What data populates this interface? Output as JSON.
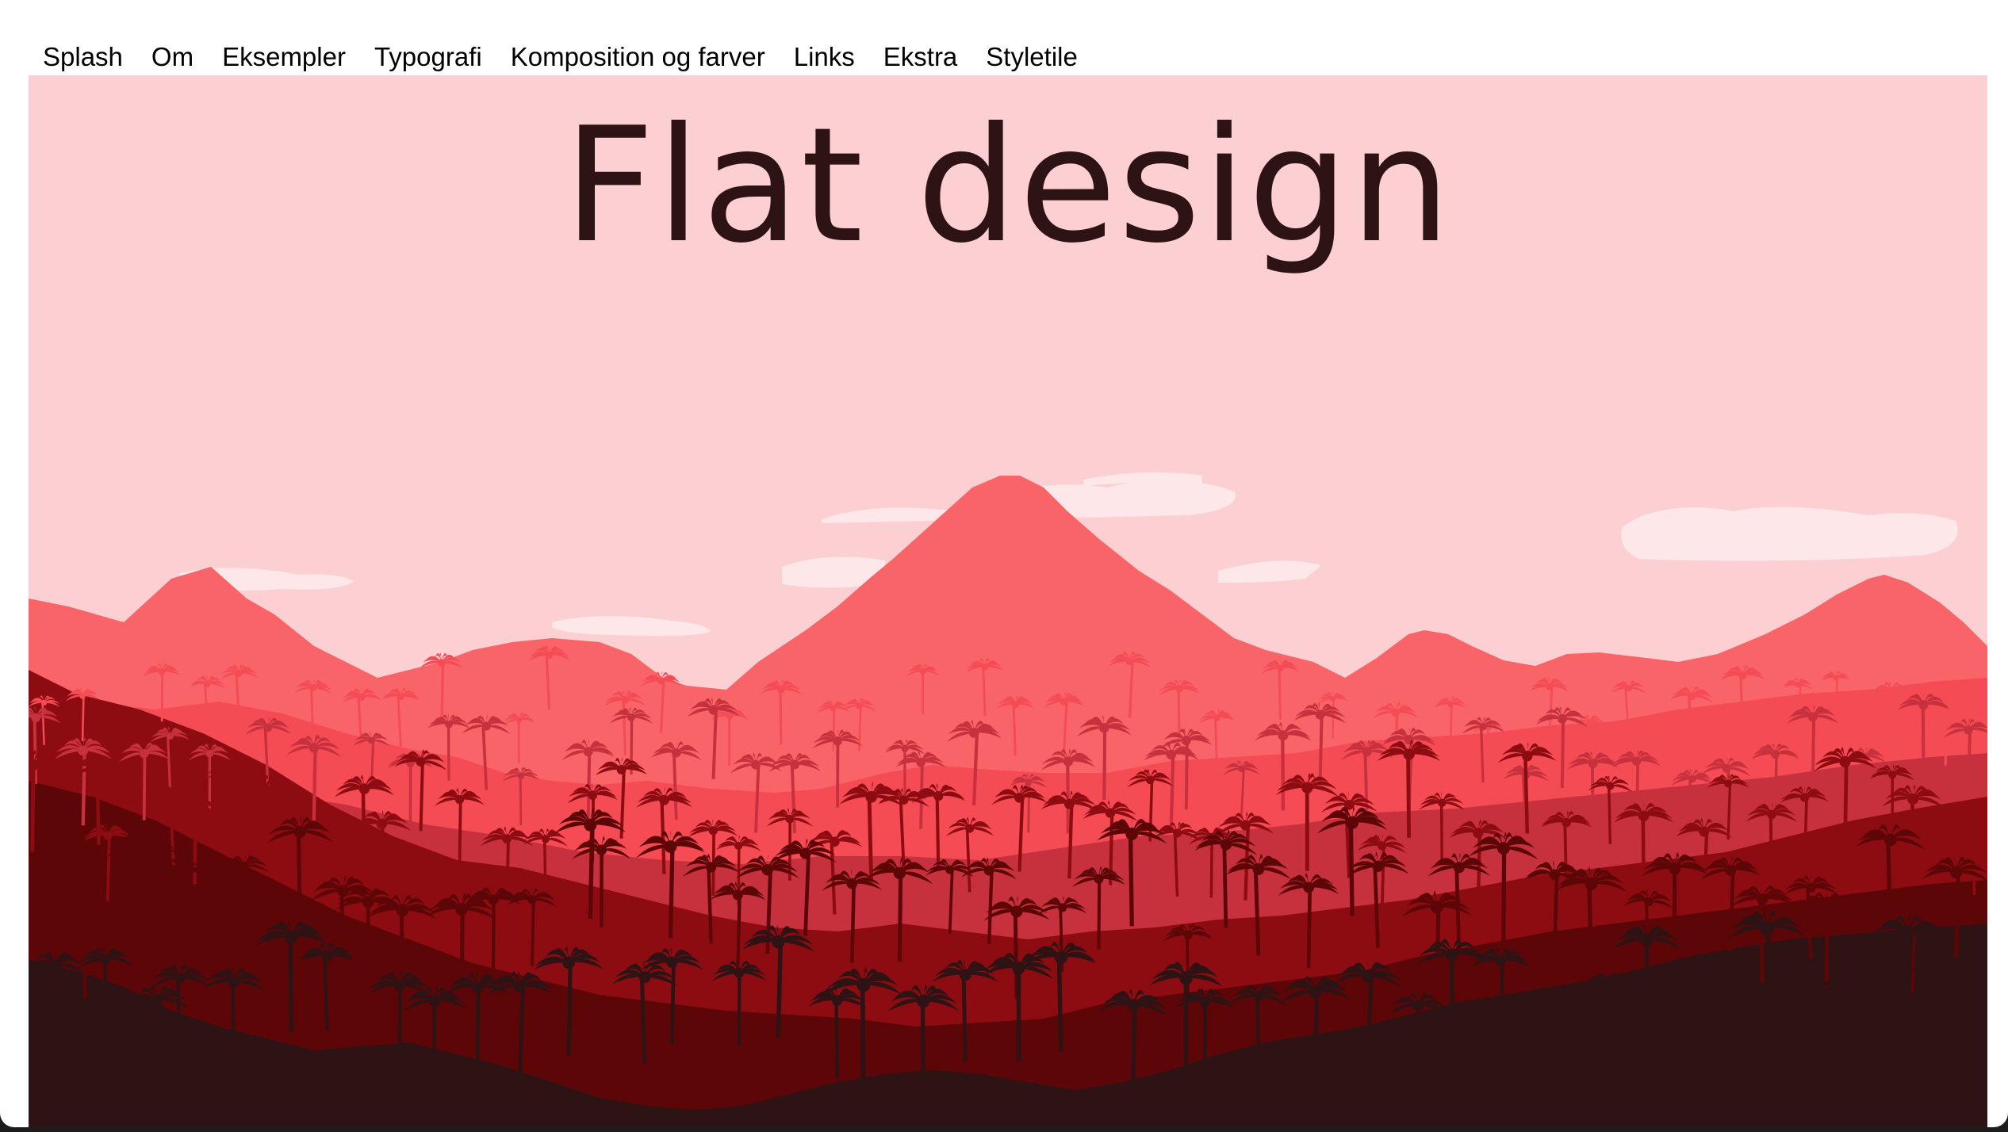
{
  "nav": {
    "items": [
      {
        "label": "Splash"
      },
      {
        "label": "Om"
      },
      {
        "label": "Eksempler"
      },
      {
        "label": "Typografi"
      },
      {
        "label": "Komposition og farver"
      },
      {
        "label": "Links"
      },
      {
        "label": "Ekstra"
      },
      {
        "label": "Styletile"
      }
    ]
  },
  "hero": {
    "title": "Flat design"
  },
  "colors": {
    "sky": "#fcd0d2",
    "cloud": "#fde7e8",
    "far_mountain": "#f86468",
    "mid_hills": "#f44b54",
    "hills_2": "#c7313d",
    "hills_3": "#8d0c12",
    "hills_4": "#5c0608",
    "foreground": "#2e1314",
    "title": "#2e1314"
  }
}
